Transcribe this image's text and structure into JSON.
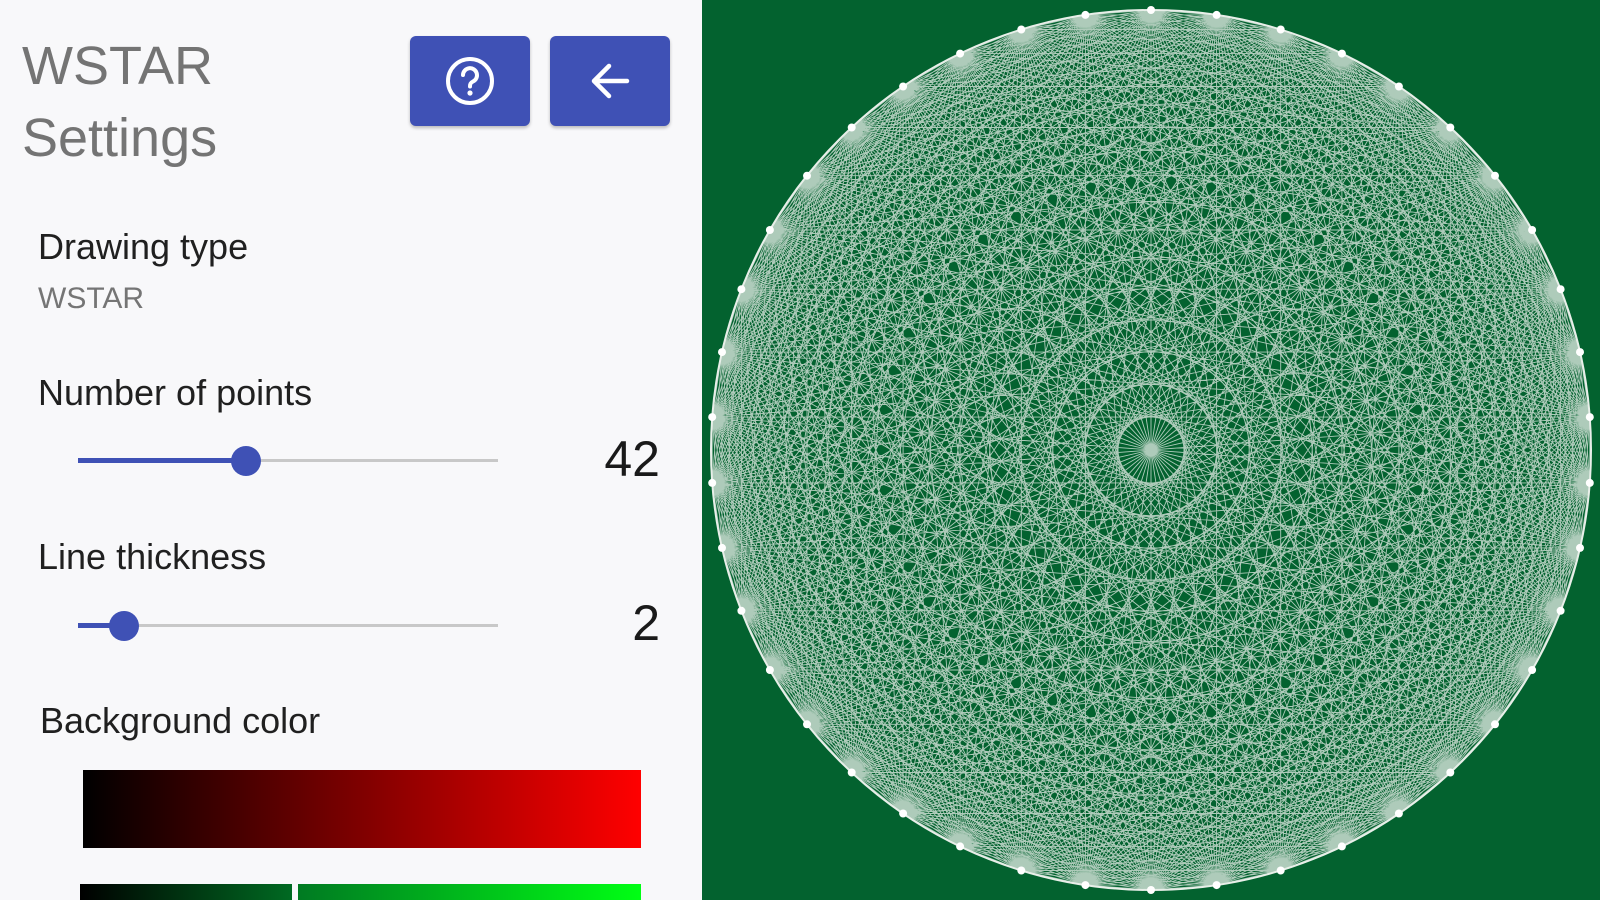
{
  "header": {
    "title_line1": "WSTAR",
    "title_line2": "Settings",
    "help_icon": "help-circle-icon",
    "back_icon": "arrow-left-icon"
  },
  "settings": {
    "drawing_type": {
      "label": "Drawing type",
      "value": "WSTAR"
    },
    "number_of_points": {
      "label": "Number of points",
      "value": "42",
      "fraction": 0.4
    },
    "line_thickness": {
      "label": "Line thickness",
      "value": "2",
      "fraction": 0.11
    },
    "background_color": {
      "label": "Background color"
    }
  },
  "colors": {
    "accent": "#3f51b5",
    "canvas_background": "#03622f",
    "pattern_color": "#e8efe9",
    "red_gradient_end": "#ff0000",
    "green_gradient_end": "#00ff14"
  }
}
